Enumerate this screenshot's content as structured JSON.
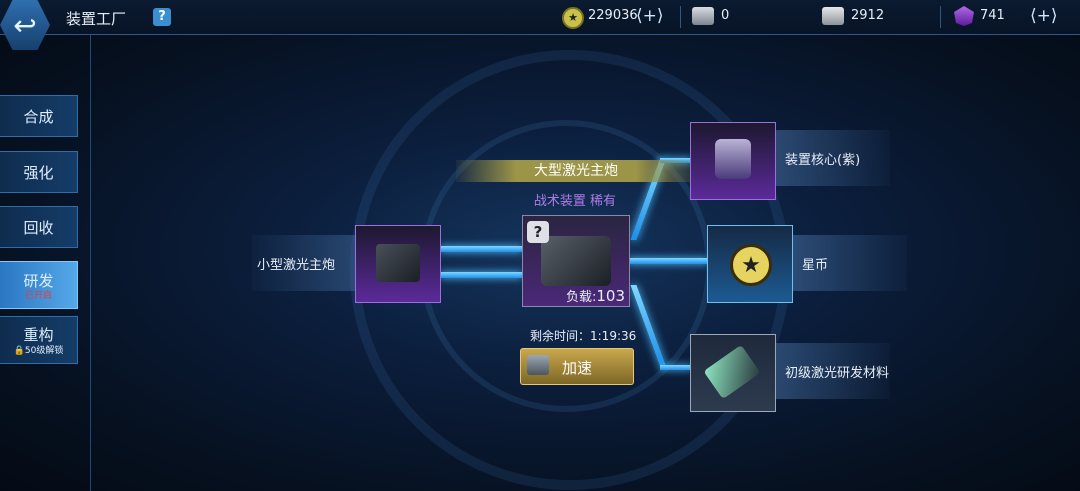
{
  "header": {
    "back_icon": "back-arrow-icon",
    "title": "装置工厂",
    "help_label": "?"
  },
  "resources": [
    {
      "name": "coins",
      "value": "229036",
      "plus": "+"
    },
    {
      "name": "device-box",
      "value": "0"
    },
    {
      "name": "metal-crate",
      "value": "2912"
    },
    {
      "name": "purple-gem",
      "value": "741",
      "plus": "+"
    }
  ],
  "sidebar": {
    "items": [
      {
        "label": "合成"
      },
      {
        "label": "强化"
      },
      {
        "label": "回收"
      },
      {
        "label": "研发",
        "status": "已开启"
      },
      {
        "label": "重构",
        "note": "50级解锁"
      }
    ]
  },
  "research": {
    "source": {
      "name": "小型激光主炮"
    },
    "target": {
      "name": "大型激光主炮",
      "rarity": "战术装置 稀有",
      "unknown": "?",
      "load_label": "负载:",
      "load_value": "103",
      "time_remaining": "剩余时间：1:19:36",
      "speedup_label": "加速"
    },
    "outputs": [
      {
        "name": "装置核心(紫)"
      },
      {
        "name": "星币"
      },
      {
        "name": "初级激光研发材料"
      }
    ]
  },
  "colors": {
    "accent_blue": "#4fc0ff",
    "gold": "#c9a84d",
    "purple": "#9c6ee0"
  }
}
